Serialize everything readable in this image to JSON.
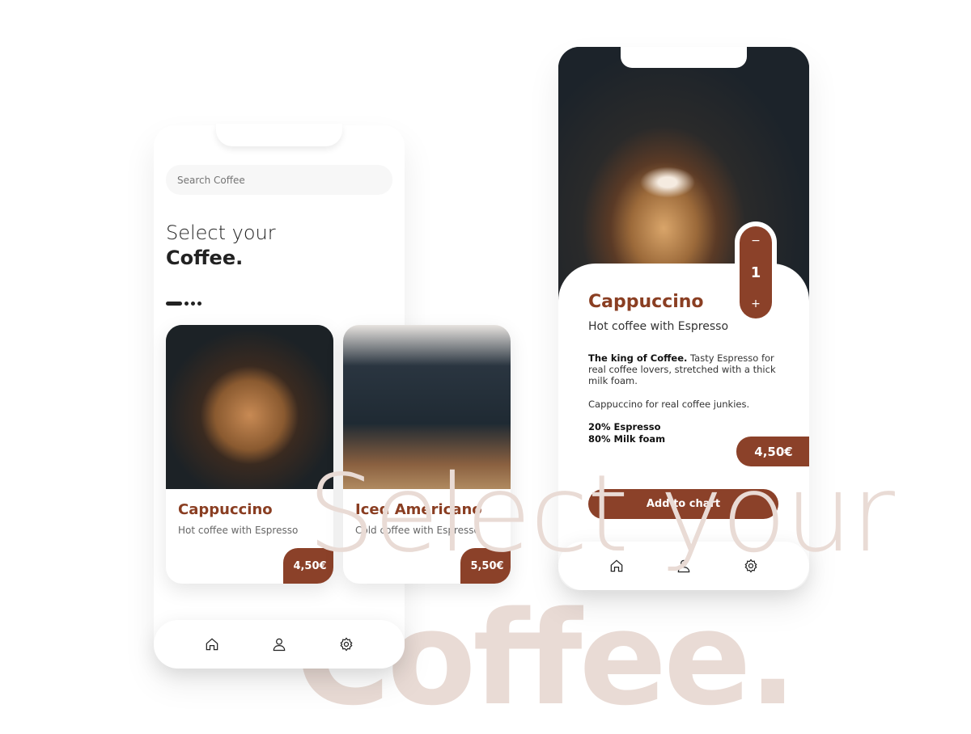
{
  "background_text": {
    "line1": "Select your",
    "line2": "Coffee."
  },
  "colors": {
    "accent": "#8b4129",
    "watermark": "#e9dbd5"
  },
  "list_screen": {
    "search": {
      "placeholder": "Search Coffee"
    },
    "heading": {
      "line1": "Select your",
      "line2": "Coffee."
    },
    "products": [
      {
        "name": "Cappuccino",
        "subtitle": "Hot coffee with Espresso",
        "price": "4,50€",
        "image": "latte-art-cappuccino-photo"
      },
      {
        "name": "Iced Americano",
        "subtitle": "Cold coffee with Espresso",
        "price": "5,50€",
        "image": "iced-americano-photo"
      }
    ],
    "nav": [
      "home-icon",
      "user-icon",
      "gear-icon"
    ]
  },
  "detail_screen": {
    "name": "Cappuccino",
    "subtitle": "Hot coffee with Espresso",
    "description_bold": "The king of Coffee.",
    "description": " Tasty Espresso for real coffee lovers, stretched with a thick milk foam.",
    "tagline": "Cappuccino for real coffee junkies.",
    "composition": [
      "20% Espresso",
      "80% Milk foam"
    ],
    "quantity": {
      "minus": "−",
      "value": "1",
      "plus": "+"
    },
    "price": "4,50€",
    "add_button": "Add to chart",
    "nav": [
      "home-icon",
      "user-icon",
      "gear-icon"
    ]
  }
}
